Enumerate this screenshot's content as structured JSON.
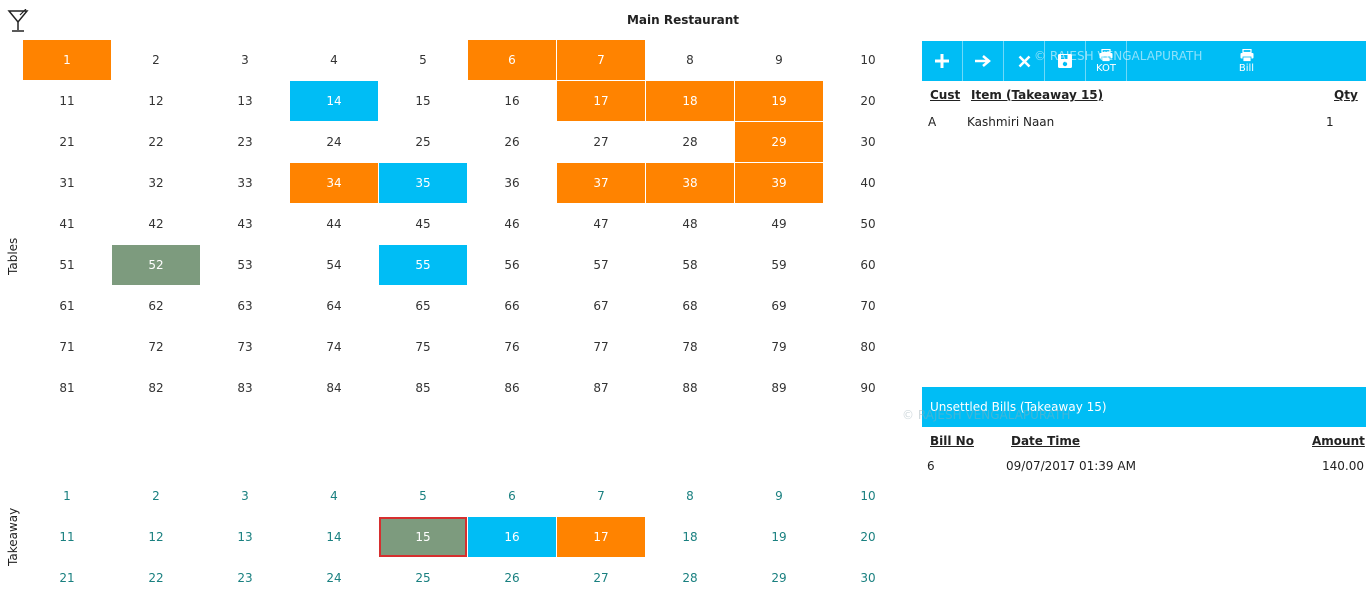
{
  "header": {
    "title": "Main Restaurant",
    "logo_icon": "cocktail-glass-icon"
  },
  "labels": {
    "tables": "Tables",
    "takeaway": "Takeaway"
  },
  "colors": {
    "occupied": "#ff8300",
    "billed": "#00bdf5",
    "selected": "#7d9b7e",
    "toolbar": "#00bdf5"
  },
  "tables": {
    "columns": 10,
    "cells": [
      {
        "n": "1",
        "s": "orange"
      },
      {
        "n": "2",
        "s": ""
      },
      {
        "n": "3",
        "s": ""
      },
      {
        "n": "4",
        "s": ""
      },
      {
        "n": "5",
        "s": ""
      },
      {
        "n": "6",
        "s": "orange"
      },
      {
        "n": "7",
        "s": "orange"
      },
      {
        "n": "8",
        "s": ""
      },
      {
        "n": "9",
        "s": ""
      },
      {
        "n": "10",
        "s": ""
      },
      {
        "n": "11",
        "s": ""
      },
      {
        "n": "12",
        "s": ""
      },
      {
        "n": "13",
        "s": ""
      },
      {
        "n": "14",
        "s": "blue"
      },
      {
        "n": "15",
        "s": ""
      },
      {
        "n": "16",
        "s": ""
      },
      {
        "n": "17",
        "s": "orange"
      },
      {
        "n": "18",
        "s": "orange"
      },
      {
        "n": "19",
        "s": "orange"
      },
      {
        "n": "20",
        "s": ""
      },
      {
        "n": "21",
        "s": ""
      },
      {
        "n": "22",
        "s": ""
      },
      {
        "n": "23",
        "s": ""
      },
      {
        "n": "24",
        "s": ""
      },
      {
        "n": "25",
        "s": ""
      },
      {
        "n": "26",
        "s": ""
      },
      {
        "n": "27",
        "s": ""
      },
      {
        "n": "28",
        "s": ""
      },
      {
        "n": "29",
        "s": "orange"
      },
      {
        "n": "30",
        "s": ""
      },
      {
        "n": "31",
        "s": ""
      },
      {
        "n": "32",
        "s": ""
      },
      {
        "n": "33",
        "s": ""
      },
      {
        "n": "34",
        "s": "orange"
      },
      {
        "n": "35",
        "s": "blue"
      },
      {
        "n": "36",
        "s": ""
      },
      {
        "n": "37",
        "s": "orange"
      },
      {
        "n": "38",
        "s": "orange"
      },
      {
        "n": "39",
        "s": "orange"
      },
      {
        "n": "40",
        "s": ""
      },
      {
        "n": "41",
        "s": ""
      },
      {
        "n": "42",
        "s": ""
      },
      {
        "n": "43",
        "s": ""
      },
      {
        "n": "44",
        "s": ""
      },
      {
        "n": "45",
        "s": ""
      },
      {
        "n": "46",
        "s": ""
      },
      {
        "n": "47",
        "s": ""
      },
      {
        "n": "48",
        "s": ""
      },
      {
        "n": "49",
        "s": ""
      },
      {
        "n": "50",
        "s": ""
      },
      {
        "n": "51",
        "s": ""
      },
      {
        "n": "52",
        "s": "green"
      },
      {
        "n": "53",
        "s": ""
      },
      {
        "n": "54",
        "s": ""
      },
      {
        "n": "55",
        "s": "blue"
      },
      {
        "n": "56",
        "s": ""
      },
      {
        "n": "57",
        "s": ""
      },
      {
        "n": "58",
        "s": ""
      },
      {
        "n": "59",
        "s": ""
      },
      {
        "n": "60",
        "s": ""
      },
      {
        "n": "61",
        "s": ""
      },
      {
        "n": "62",
        "s": ""
      },
      {
        "n": "63",
        "s": ""
      },
      {
        "n": "64",
        "s": ""
      },
      {
        "n": "65",
        "s": ""
      },
      {
        "n": "66",
        "s": ""
      },
      {
        "n": "67",
        "s": ""
      },
      {
        "n": "68",
        "s": ""
      },
      {
        "n": "69",
        "s": ""
      },
      {
        "n": "70",
        "s": ""
      },
      {
        "n": "71",
        "s": ""
      },
      {
        "n": "72",
        "s": ""
      },
      {
        "n": "73",
        "s": ""
      },
      {
        "n": "74",
        "s": ""
      },
      {
        "n": "75",
        "s": ""
      },
      {
        "n": "76",
        "s": ""
      },
      {
        "n": "77",
        "s": ""
      },
      {
        "n": "78",
        "s": ""
      },
      {
        "n": "79",
        "s": ""
      },
      {
        "n": "80",
        "s": ""
      },
      {
        "n": "81",
        "s": ""
      },
      {
        "n": "82",
        "s": ""
      },
      {
        "n": "83",
        "s": ""
      },
      {
        "n": "84",
        "s": ""
      },
      {
        "n": "85",
        "s": ""
      },
      {
        "n": "86",
        "s": ""
      },
      {
        "n": "87",
        "s": ""
      },
      {
        "n": "88",
        "s": ""
      },
      {
        "n": "89",
        "s": ""
      },
      {
        "n": "90",
        "s": ""
      }
    ]
  },
  "takeaway": {
    "columns": 10,
    "cells": [
      {
        "n": "1",
        "s": ""
      },
      {
        "n": "2",
        "s": ""
      },
      {
        "n": "3",
        "s": ""
      },
      {
        "n": "4",
        "s": ""
      },
      {
        "n": "5",
        "s": ""
      },
      {
        "n": "6",
        "s": ""
      },
      {
        "n": "7",
        "s": ""
      },
      {
        "n": "8",
        "s": ""
      },
      {
        "n": "9",
        "s": ""
      },
      {
        "n": "10",
        "s": ""
      },
      {
        "n": "11",
        "s": ""
      },
      {
        "n": "12",
        "s": ""
      },
      {
        "n": "13",
        "s": ""
      },
      {
        "n": "14",
        "s": ""
      },
      {
        "n": "15",
        "s": "green sel"
      },
      {
        "n": "16",
        "s": "blue"
      },
      {
        "n": "17",
        "s": "orange"
      },
      {
        "n": "18",
        "s": ""
      },
      {
        "n": "19",
        "s": ""
      },
      {
        "n": "20",
        "s": ""
      },
      {
        "n": "21",
        "s": ""
      },
      {
        "n": "22",
        "s": ""
      },
      {
        "n": "23",
        "s": ""
      },
      {
        "n": "24",
        "s": ""
      },
      {
        "n": "25",
        "s": ""
      },
      {
        "n": "26",
        "s": ""
      },
      {
        "n": "27",
        "s": ""
      },
      {
        "n": "28",
        "s": ""
      },
      {
        "n": "29",
        "s": ""
      },
      {
        "n": "30",
        "s": ""
      }
    ]
  },
  "toolbar": {
    "add_icon": "plus-icon",
    "move_icon": "arrow-right-icon",
    "delete_icon": "close-icon",
    "save_icon": "save-icon",
    "kot_label": "KOT",
    "bill_label": "Bill",
    "watermark": "© RAJESH VENGALAPURATH"
  },
  "order": {
    "headers": {
      "cust": "Cust",
      "item": "Item (Takeaway 15)",
      "qty": "Qty"
    },
    "rows": [
      {
        "cust": "A",
        "item": "Kashmiri Naan",
        "qty": "1"
      }
    ]
  },
  "unsettled": {
    "title": "Unsettled Bills (Takeaway 15)",
    "watermark": "© RAJESH VENGALAPURATH",
    "headers": {
      "bill_no": "Bill No",
      "date_time": "Date Time",
      "amount": "Amount"
    },
    "rows": [
      {
        "bill_no": "6",
        "date_time": "09/07/2017 01:39 AM",
        "amount": "140.00"
      }
    ]
  }
}
